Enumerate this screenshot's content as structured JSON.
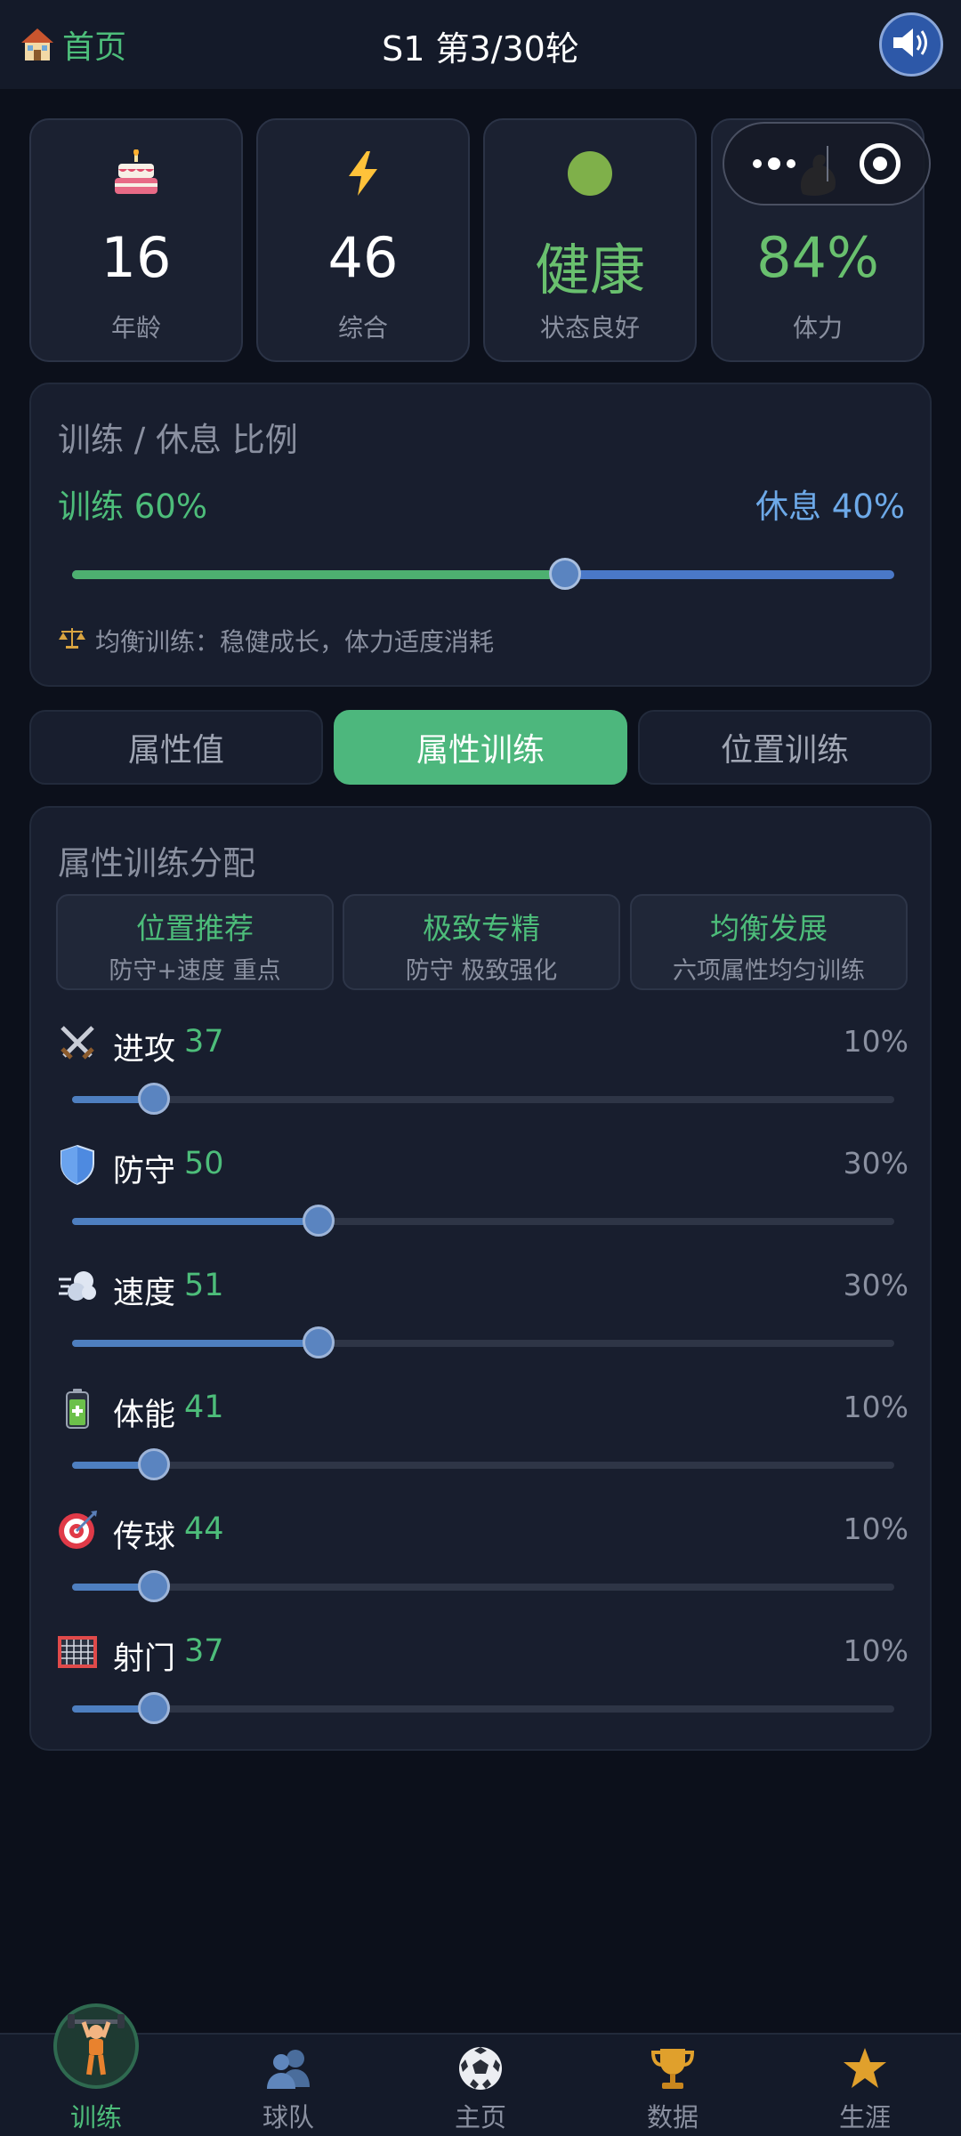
{
  "header": {
    "home_label": "首页",
    "round_title": "S1 第3/30轮"
  },
  "stats": [
    {
      "icon": "birthday-cake-icon",
      "value": "16",
      "label": "年龄"
    },
    {
      "icon": "lightning-icon",
      "value": "46",
      "label": "综合"
    },
    {
      "icon": "green-dot-icon",
      "value": "健康",
      "label": "状态良好"
    },
    {
      "icon": "flexed-bicep-icon",
      "value": "84%",
      "label": "体力"
    }
  ],
  "ratio": {
    "title": "训练 / 休息 比例",
    "train_label": "训练 60%",
    "rest_label": "休息 40%",
    "train_fraction": 0.6,
    "tip": "均衡训练：稳健成长，体力适度消耗"
  },
  "tabs": [
    {
      "label": "属性值",
      "active": false
    },
    {
      "label": "属性训练",
      "active": true
    },
    {
      "label": "位置训练",
      "active": false
    }
  ],
  "allocation": {
    "title": "属性训练分配",
    "presets": [
      {
        "title": "位置推荐",
        "sub": "防守+速度 重点"
      },
      {
        "title": "极致专精",
        "sub": "防守 极致强化"
      },
      {
        "title": "均衡发展",
        "sub": "六项属性均匀训练"
      }
    ],
    "attributes": [
      {
        "icon": "crossed-swords-icon",
        "name": "进攻",
        "value": "37",
        "pct": "10%",
        "fraction": 0.1
      },
      {
        "icon": "shield-icon",
        "name": "防守",
        "value": "50",
        "pct": "30%",
        "fraction": 0.3
      },
      {
        "icon": "wind-icon",
        "name": "速度",
        "value": "51",
        "pct": "30%",
        "fraction": 0.3
      },
      {
        "icon": "battery-icon",
        "name": "体能",
        "value": "41",
        "pct": "10%",
        "fraction": 0.1
      },
      {
        "icon": "target-icon",
        "name": "传球",
        "value": "44",
        "pct": "10%",
        "fraction": 0.1
      },
      {
        "icon": "goal-net-icon",
        "name": "射门",
        "value": "37",
        "pct": "10%",
        "fraction": 0.1
      }
    ]
  },
  "nav": [
    {
      "icon": "weightlifter-icon",
      "label": "训练",
      "active": true
    },
    {
      "icon": "team-icon",
      "label": "球队",
      "active": false
    },
    {
      "icon": "soccer-ball-icon",
      "label": "主页",
      "active": false
    },
    {
      "icon": "trophy-icon",
      "label": "数据",
      "active": false
    },
    {
      "icon": "star-icon",
      "label": "生涯",
      "active": false
    }
  ],
  "colors": {
    "accent_green": "#4dbd7a",
    "rest_blue": "#6da9e8",
    "background": "#0c101b",
    "card": "#181e2e"
  }
}
